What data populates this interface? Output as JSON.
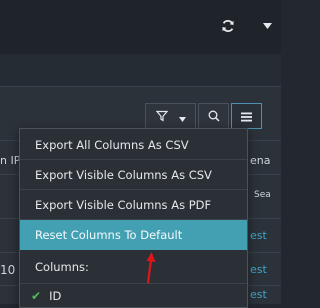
{
  "background": {
    "header_left": "n IP",
    "header_right": "ena",
    "sub_right": "Sea",
    "row1_right": "est",
    "row2_left": "10",
    "row2_right": "est",
    "row3_right": "est"
  },
  "menu": {
    "items": [
      {
        "label": "Export All Columns As CSV"
      },
      {
        "label": "Export Visible Columns As CSV"
      },
      {
        "label": "Export Visible Columns As PDF"
      },
      {
        "label": "Reset Columns To Default"
      }
    ],
    "columns_header": "Columns:",
    "columns": [
      {
        "label": "ID",
        "checked": true
      }
    ]
  },
  "colors": {
    "accent": "#43a0b2",
    "check": "#4cbf57",
    "arrow": "#e0141b",
    "link": "#3fa7c9"
  }
}
